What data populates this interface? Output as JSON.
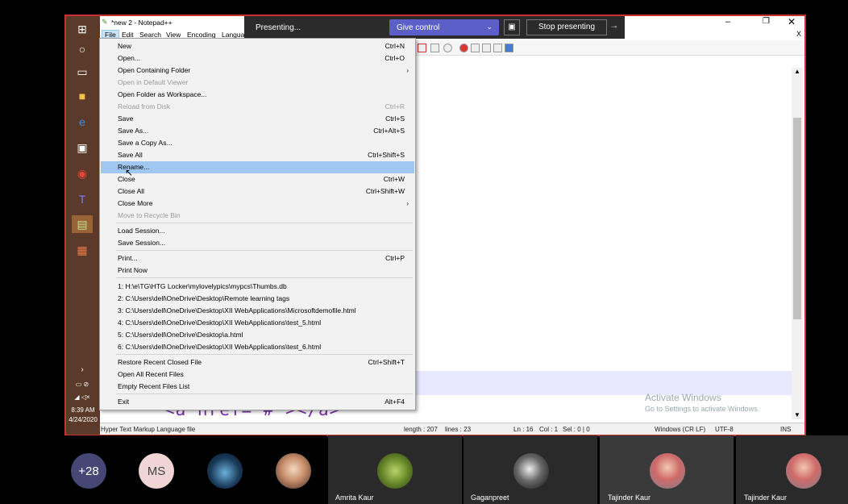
{
  "presenting_bar": {
    "status": "Presenting...",
    "give_control": "Give control",
    "stop_presenting": "Stop presenting"
  },
  "window": {
    "title": "*new 2 - Notepad++",
    "close_tab": "X"
  },
  "menubar": [
    "File",
    "Edit",
    "Search",
    "View",
    "Encoding",
    "Languag"
  ],
  "file_menu": {
    "items": [
      {
        "label": "New",
        "shortcut": "Ctrl+N"
      },
      {
        "label": "Open...",
        "shortcut": "Ctrl+O"
      },
      {
        "label": "Open Containing Folder",
        "shortcut": ""
      },
      {
        "label": "Open in Default Viewer",
        "shortcut": ""
      },
      {
        "label": "Open Folder as Workspace...",
        "shortcut": ""
      },
      {
        "label": "Reload from Disk",
        "shortcut": "Ctrl+R"
      },
      {
        "label": "Save",
        "shortcut": "Ctrl+S"
      },
      {
        "label": "Save As...",
        "shortcut": "Ctrl+Alt+S"
      },
      {
        "label": "Save a Copy As...",
        "shortcut": ""
      },
      {
        "label": "Save All",
        "shortcut": "Ctrl+Shift+S"
      },
      {
        "label": "Rename...",
        "shortcut": ""
      },
      {
        "label": "Close",
        "shortcut": "Ctrl+W"
      },
      {
        "label": "Close All",
        "shortcut": "Ctrl+Shift+W"
      },
      {
        "label": "Close More",
        "shortcut": ""
      },
      {
        "label": "Move to Recycle Bin",
        "shortcut": ""
      },
      {
        "label": "Load Session...",
        "shortcut": ""
      },
      {
        "label": "Save Session...",
        "shortcut": ""
      },
      {
        "label": "Print...",
        "shortcut": "Ctrl+P"
      },
      {
        "label": "Print Now",
        "shortcut": ""
      },
      {
        "label": "1: H:\\e\\TG\\HTG Locker\\mylovelypics\\mypcs\\Thumbs.db",
        "shortcut": ""
      },
      {
        "label": "2: C:\\Users\\dell\\OneDrive\\Desktop\\Remote learning tags",
        "shortcut": ""
      },
      {
        "label": "3: C:\\Users\\dell\\OneDrive\\Desktop\\XII WebApplications\\Microsoftdemofile.html",
        "shortcut": ""
      },
      {
        "label": "4: C:\\Users\\dell\\OneDrive\\Desktop\\XII WebApplications\\test_5.html",
        "shortcut": ""
      },
      {
        "label": "5: C:\\Users\\dell\\OneDrive\\Desktop\\a.html",
        "shortcut": ""
      },
      {
        "label": "6: C:\\Users\\dell\\OneDrive\\Desktop\\XII WebApplications\\test_6.html",
        "shortcut": ""
      },
      {
        "label": "Restore Recent Closed File",
        "shortcut": "Ctrl+Shift+T"
      },
      {
        "label": "Open All Recent Files",
        "shortcut": ""
      },
      {
        "label": "Empty Recent Files List",
        "shortcut": ""
      },
      {
        "label": "Exit",
        "shortcut": "Alt+F4"
      }
    ]
  },
  "editor": {
    "code_fragment": "<a href=\"#\"></a>"
  },
  "statusbar": {
    "language": "Hyper Text Markup Language file",
    "length": "length : 207",
    "lines": "lines : 23",
    "ln": "Ln : 16",
    "col": "Col : 1",
    "sel": "Sel : 0 | 0",
    "eol": "Windows (CR LF)",
    "encoding": "UTF-8",
    "mode": "INS"
  },
  "watermark": {
    "line1": "Activate Windows",
    "line2": "Go to Settings to activate Windows."
  },
  "taskbar": {
    "time": "8:39 AM",
    "date": "4/24/2020"
  },
  "participants": {
    "overflow": "+28",
    "initials": "MS",
    "names": [
      "Amrita Kaur",
      "Gaganpreet",
      "Tajinder Kaur",
      "Tajinder Kaur"
    ]
  },
  "colors": {
    "accent": "#5b5fc7",
    "frame": "#c83232",
    "highlight": "#9fc7ef",
    "taskbar": "#5b3a29"
  }
}
